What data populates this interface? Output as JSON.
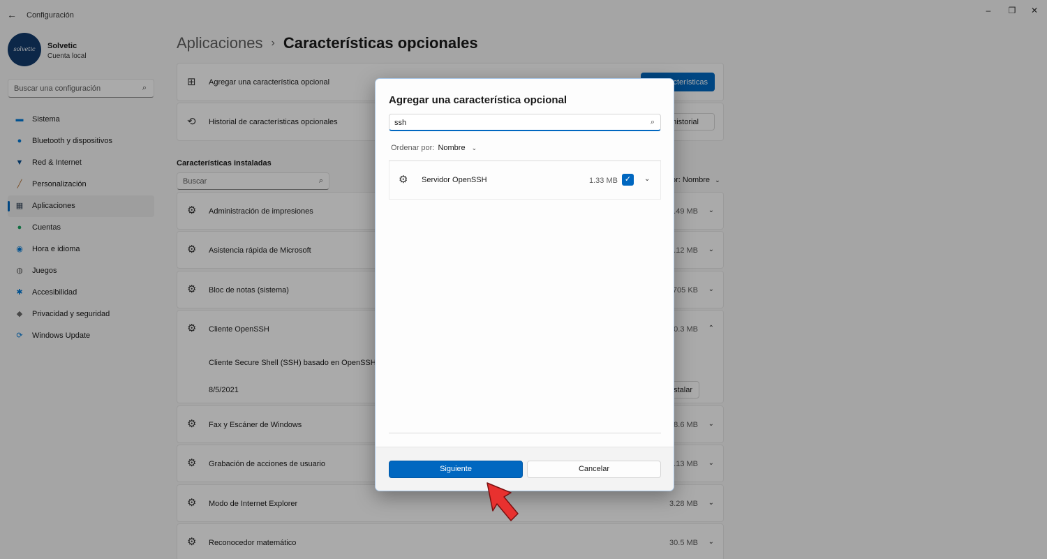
{
  "window": {
    "title": "Configuración",
    "controls": {
      "minimize": "–",
      "maximize": "❐",
      "close": "✕"
    }
  },
  "profile": {
    "name": "Solvetic",
    "subtitle": "Cuenta local",
    "avatar_text": "solvetic"
  },
  "search": {
    "placeholder": "Buscar una configuración"
  },
  "nav": {
    "items": [
      {
        "label": "Sistema",
        "icon": "monitor-icon",
        "glyph": "▬",
        "color": "#0078d4"
      },
      {
        "label": "Bluetooth y dispositivos",
        "icon": "bluetooth-icon",
        "glyph": "●",
        "color": "#0078d4"
      },
      {
        "label": "Red & Internet",
        "icon": "wifi-icon",
        "glyph": "▼",
        "color": "#0a4f8f"
      },
      {
        "label": "Personalización",
        "icon": "brush-icon",
        "glyph": "╱",
        "color": "#b06a2b"
      },
      {
        "label": "Aplicaciones",
        "icon": "apps-icon",
        "glyph": "▦",
        "color": "#3a4a5e",
        "active": true
      },
      {
        "label": "Cuentas",
        "icon": "person-icon",
        "glyph": "●",
        "color": "#1aa260"
      },
      {
        "label": "Hora e idioma",
        "icon": "globe-clock-icon",
        "glyph": "◉",
        "color": "#0078d4"
      },
      {
        "label": "Juegos",
        "icon": "gamepad-icon",
        "glyph": "◍",
        "color": "#6b6b6b"
      },
      {
        "label": "Accesibilidad",
        "icon": "accessibility-icon",
        "glyph": "✱",
        "color": "#0078d4"
      },
      {
        "label": "Privacidad y seguridad",
        "icon": "shield-icon",
        "glyph": "◆",
        "color": "#6b6b6b"
      },
      {
        "label": "Windows Update",
        "icon": "update-icon",
        "glyph": "⟳",
        "color": "#0078d4"
      }
    ]
  },
  "breadcrumb": {
    "parent": "Aplicaciones",
    "separator": "›",
    "current": "Características opcionales"
  },
  "cards": {
    "add_label": "Agregar una característica opcional",
    "add_button": "Ver características",
    "add_button_visible": "racterísticas",
    "history_label": "Historial de características opcionales",
    "history_button_visible": "historial"
  },
  "installed": {
    "title": "Características instaladas",
    "search_placeholder": "Buscar",
    "sort_visible": "or: Nombre",
    "items": [
      {
        "name": "Administración de impresiones",
        "size_visible": ".49 MB",
        "chevron": "⌄"
      },
      {
        "name": "Asistencia rápida de Microsoft",
        "size_visible": "3.12 MB",
        "chevron": "⌄"
      },
      {
        "name": "Bloc de notas (sistema)",
        "size_visible": "705 KB",
        "chevron": "⌄"
      },
      {
        "name": "Cliente OpenSSH",
        "size_visible": "0.3 MB",
        "chevron": "⌃"
      },
      {
        "name": "Fax y Escáner de Windows",
        "size_visible": "8.6 MB",
        "chevron": "⌄"
      },
      {
        "name": "Grabación de acciones de usuario",
        "size_visible": "1.13 MB",
        "chevron": "⌄"
      },
      {
        "name": "Modo de Internet Explorer",
        "size_visible": "3.28 MB",
        "chevron": "⌄"
      },
      {
        "name": "Reconocedor matemático",
        "size_visible": "30.5 MB",
        "chevron": "⌄"
      }
    ],
    "expanded_description": "Cliente Secure Shell (SSH) basado en OpenSSH, p",
    "expanded_date": "8/5/2021",
    "expanded_button_visible": "stalar"
  },
  "dialog": {
    "title": "Agregar una característica opcional",
    "search_value": "ssh",
    "sort_label": "Ordenar por:",
    "sort_value": "Nombre",
    "results": [
      {
        "name": "Servidor OpenSSH",
        "size": "1.33 MB",
        "checked": true
      }
    ],
    "next_button": "Siguiente",
    "cancel_button": "Cancelar"
  },
  "colors": {
    "accent": "#0067c0",
    "pointer": "#e8312f",
    "background": "#f3f3f3"
  }
}
